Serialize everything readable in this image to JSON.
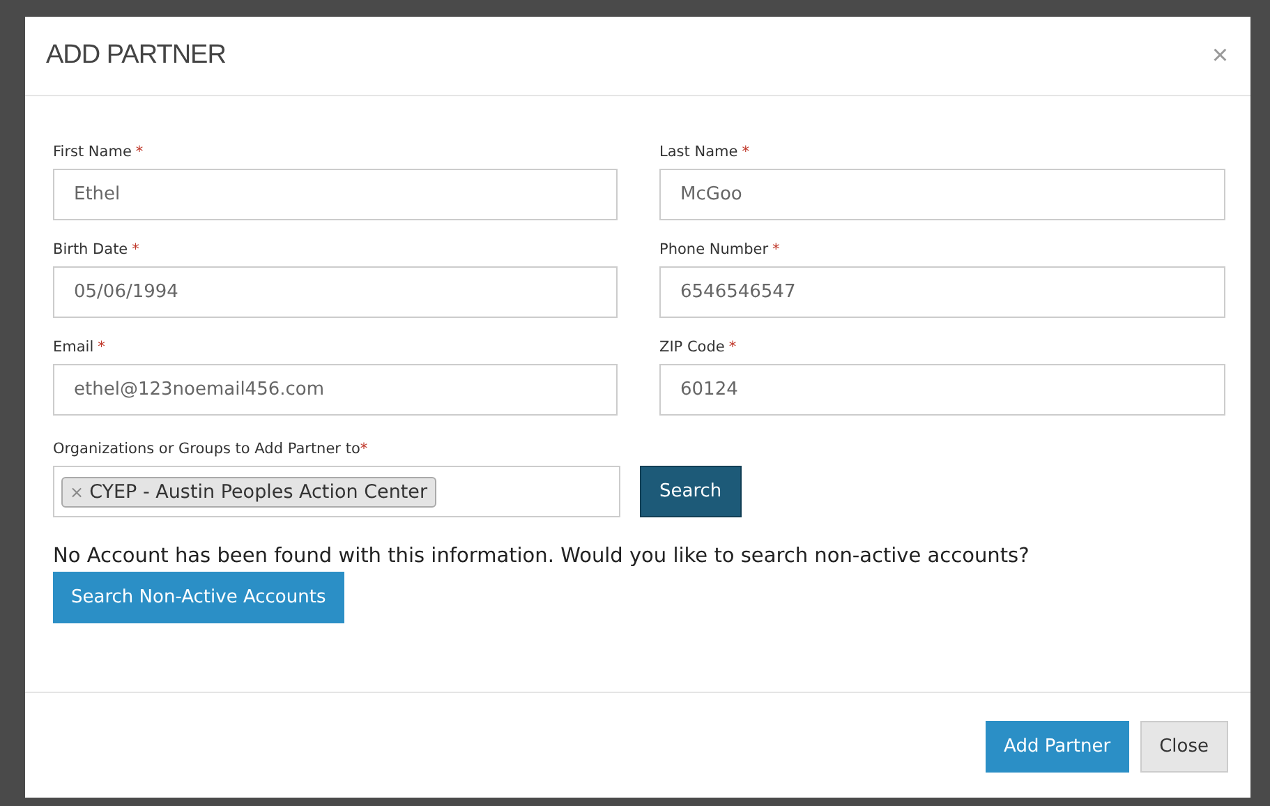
{
  "dialog": {
    "title": "ADD PARTNER",
    "close": "×"
  },
  "fields": [
    {
      "label": "First Name",
      "required_mark": "*",
      "value": "Ethel"
    },
    {
      "label": "Last Name",
      "required_mark": "*",
      "value": "McGoo"
    },
    {
      "label": "Birth Date",
      "required_mark": "*",
      "value": "05/06/1994"
    },
    {
      "label": "Phone Number",
      "required_mark": "*",
      "value": "6546546547"
    },
    {
      "label": "Email",
      "required_mark": "*",
      "value": "ethel@123noemail456.com"
    },
    {
      "label": "ZIP Code",
      "required_mark": "*",
      "value": "60124"
    }
  ],
  "organizations": {
    "label": "Organizations or Groups to Add Partner to",
    "required_mark": "*",
    "tags": [
      {
        "remove": "×",
        "text": "CYEP - Austin Peoples Action Center"
      }
    ],
    "search_button": "Search"
  },
  "message": "No Account has been found with this information. Would you like to search non-active accounts?",
  "search_inactive_button": "Search Non-Active Accounts",
  "footer_buttons": [
    {
      "label": "Add Partner",
      "kind": "primary"
    },
    {
      "label": "Close",
      "kind": "default"
    }
  ]
}
